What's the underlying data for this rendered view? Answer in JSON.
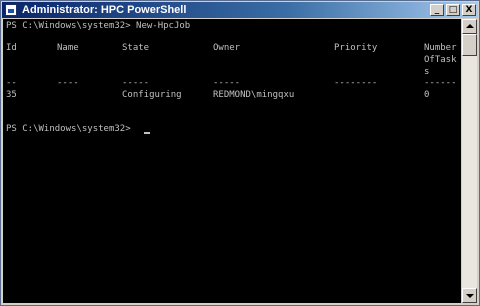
{
  "window": {
    "title": "Administrator: HPC PowerShell",
    "controls": {
      "minimize": "_",
      "maximize": "□",
      "close": "X"
    }
  },
  "console": {
    "command_line": "PS C:\\Windows\\system32> New-HpcJob",
    "headers": {
      "id": "Id",
      "name": "Name",
      "state": "State",
      "owner": "Owner",
      "priority": "Priority",
      "tasks_1": "Number",
      "tasks_2": "OfTask",
      "tasks_3": "s"
    },
    "separators": {
      "id": "--",
      "name": "----",
      "state": "-----",
      "owner": "-----",
      "priority": "--------",
      "tasks": "------"
    },
    "row": {
      "id": "35",
      "name": "",
      "state": "Configuring",
      "owner": "REDMOND\\mingqxu",
      "priority": "",
      "tasks": "0"
    },
    "prompt": "PS C:\\Windows\\system32> "
  },
  "colors": {
    "console_bg": "#000000",
    "console_text": "#c0c0c0",
    "titlebar_start": "#0a246a",
    "titlebar_end": "#a6caf0"
  },
  "icons": [
    "powershell-app-icon",
    "minimize-icon",
    "maximize-icon",
    "close-icon",
    "scroll-up-arrow-icon",
    "scroll-down-arrow-icon"
  ]
}
